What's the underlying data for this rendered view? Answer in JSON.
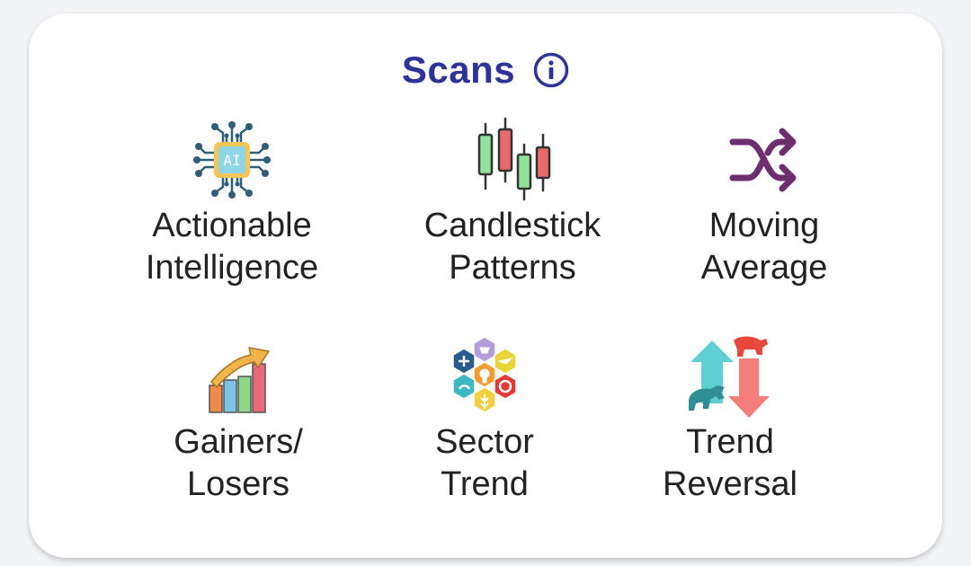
{
  "header": {
    "title": "Scans",
    "info_icon": "info-icon",
    "accent_color": "#2f3397"
  },
  "tiles": [
    {
      "line1": "Actionable",
      "line2": "Intelligence",
      "icon": "ai-chip-icon"
    },
    {
      "line1": "Candlestick",
      "line2": "Patterns",
      "icon": "candlestick-icon"
    },
    {
      "line1": "Moving",
      "line2": "Average",
      "icon": "shuffle-arrows-icon"
    },
    {
      "line1": "Gainers/",
      "line2": "Losers",
      "icon": "rising-bars-icon"
    },
    {
      "line1": "Sector",
      "line2": "Trend",
      "icon": "sector-hexagons-icon"
    },
    {
      "line1": "Trend",
      "line2": "Reversal",
      "icon": "bull-bear-icon"
    }
  ],
  "ai_chip_text": "AI"
}
